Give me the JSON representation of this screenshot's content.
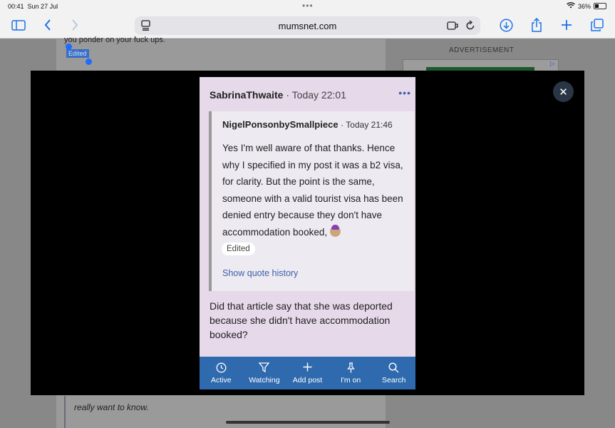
{
  "status": {
    "time": "00:41",
    "date": "Sun 27 Jul",
    "battery": "36%",
    "battery_level": 0.36
  },
  "browser": {
    "url": "mumsnet.com"
  },
  "background": {
    "text_top": "you ponder on your fuck ups.",
    "edited_label": "Edited",
    "advertisement": "ADVERTISEMENT",
    "text_bottom": "really want to know."
  },
  "card": {
    "author": "SabrinaThwaite",
    "time": "Today 22:01",
    "quote": {
      "author": "NigelPonsonbySmallpiece",
      "time": "Today 21:46",
      "body": "Yes I'm well aware of that thanks. Hence why I specified in my post it was a b2 visa, for clarity. But the point is the same, someone with a valid tourist visa has been denied entry because they don't have accommodation booked,",
      "edited": "Edited",
      "history_link": "Show quote history"
    },
    "reply": "Did that article say that she was deported because she didn't have accommodation booked?"
  },
  "nav": [
    {
      "label": "Active",
      "icon": "clock-icon",
      "glyph": "◷"
    },
    {
      "label": "Watching",
      "icon": "filter-icon",
      "glyph": "▽"
    },
    {
      "label": "Add post",
      "icon": "plus-icon",
      "glyph": "+"
    },
    {
      "label": "I'm on",
      "icon": "pin-icon",
      "glyph": "⚲"
    },
    {
      "label": "Search",
      "icon": "search-icon",
      "glyph": "⌕"
    }
  ],
  "colors": {
    "accent": "#2f6aae",
    "card_bg": "#e6d9ea",
    "link": "#3a62a8"
  }
}
